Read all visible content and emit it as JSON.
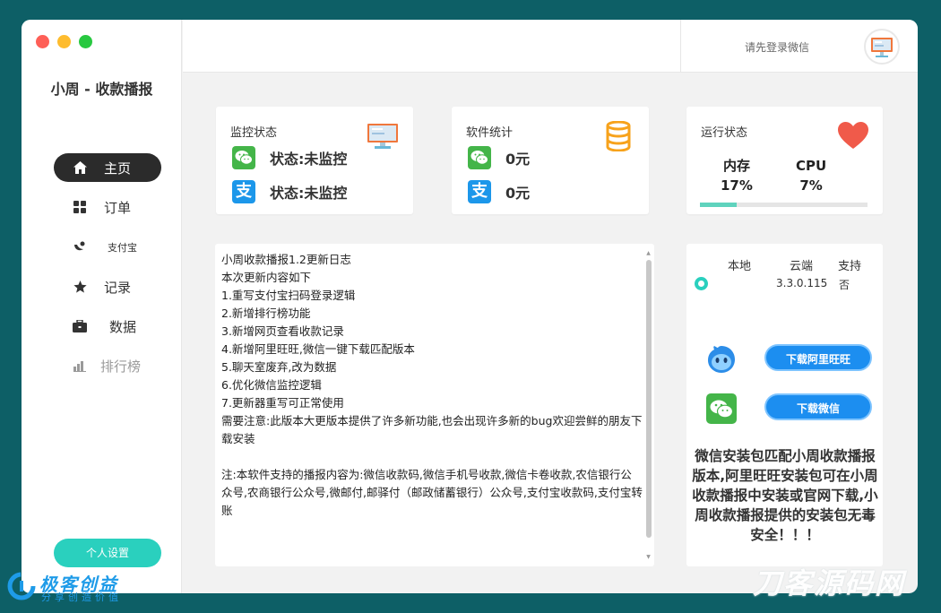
{
  "app": {
    "title": "小周 - 收款播报"
  },
  "nav": {
    "items": [
      {
        "label": "主页",
        "icon": "home-icon"
      },
      {
        "label": "订单",
        "icon": "grid-icon"
      },
      {
        "label": "支付宝",
        "icon": "alipay-icon"
      },
      {
        "label": "记录",
        "icon": "star-icon"
      },
      {
        "label": "数据",
        "icon": "briefcase-icon"
      },
      {
        "label": "排行榜",
        "icon": "bar-chart-icon"
      }
    ],
    "settings_label": "个人设置"
  },
  "header": {
    "login_text": "请先登录微信"
  },
  "monitor": {
    "title": "监控状态",
    "wechat_status": "状态:未监控",
    "alipay_status": "状态:未监控"
  },
  "stats": {
    "title": "软件统计",
    "wechat_amount": "0元",
    "alipay_amount": "0元"
  },
  "runtime": {
    "title": "运行状态",
    "memory_label": "内存",
    "memory_value": "17%",
    "cpu_label": "CPU",
    "cpu_value": "7%",
    "progress_fraction": 0.22
  },
  "changelog": {
    "lines": [
      "小周收款播报1.2更新日志",
      "本次更新内容如下",
      "1.重写支付宝扫码登录逻辑",
      "2.新增排行榜功能",
      "3.新增网页查看收款记录",
      "4.新增阿里旺旺,微信一键下载匹配版本",
      "5.聊天室废弃,改为数据",
      "6.优化微信监控逻辑",
      "7.更新器重写可正常使用",
      "需要注意:此版本大更版本提供了许多新功能,也会出现许多新的bug欢迎尝鲜的朋友下载安装",
      "",
      "注:本软件支持的播报内容为:微信收款码,微信手机号收款,微信卡卷收款,农信银行公众号,农商银行公众号,微邮付,邮驿付（邮政储蓄银行）公众号,支付宝收款码,支付宝转账"
    ]
  },
  "version": {
    "col_local": "本地",
    "col_cloud": "云端",
    "col_support": "支持",
    "cloud_value": "3.3.0.115",
    "support_value": "否",
    "download_wangwang": "下载阿里旺旺",
    "download_wechat": "下载微信",
    "note": "微信安装包匹配小周收款播报版本,阿里旺旺安装包可在小周收款播报中安装或官网下载,小周收款播报提供的安装包无毒安全！！！"
  },
  "watermarks": {
    "left_title": "极客创益",
    "left_sub": "分享创造价值",
    "right": "刀客源码网"
  },
  "colors": {
    "accent": "#2ad0be",
    "wechat": "#44b549",
    "alipay": "#1c97ea",
    "button_blue": "#1c8ef0"
  }
}
